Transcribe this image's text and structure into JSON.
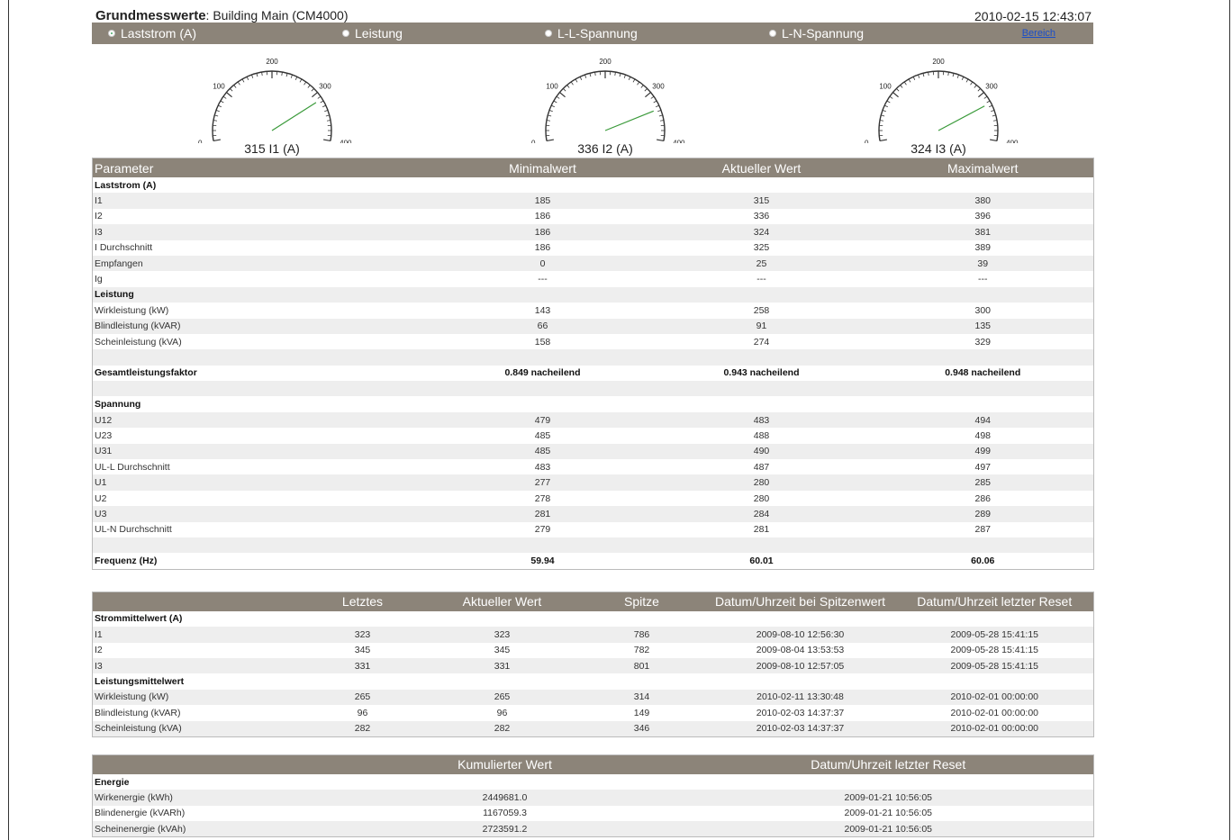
{
  "header": {
    "title_bold": "Grundmesswerte",
    "title_rest": ": Building Main (CM4000)",
    "timestamp": "2010-02-15 12:43:07"
  },
  "radios": [
    {
      "label": "Laststrom (A)",
      "selected": true
    },
    {
      "label": "Leistung",
      "selected": false
    },
    {
      "label": "L-L-Spannung",
      "selected": false
    },
    {
      "label": "L-N-Spannung",
      "selected": false
    }
  ],
  "bereich_link": "Bereich",
  "gauges": [
    {
      "value": 315,
      "label": "315 I1 (A)"
    },
    {
      "value": 336,
      "label": "336 I2 (A)"
    },
    {
      "value": 324,
      "label": "324 I3 (A)"
    }
  ],
  "gauge_scale": {
    "ticks": [
      "0",
      "100",
      "200",
      "300",
      "400"
    ],
    "min": 0,
    "max": 400
  },
  "main_table": {
    "headers": [
      "Parameter",
      "Minimalwert",
      "Aktueller Wert",
      "Maximalwert"
    ],
    "rows": [
      {
        "type": "section",
        "cells": [
          "Laststrom (A)",
          "",
          "",
          ""
        ]
      },
      {
        "type": "data",
        "cells": [
          "I1",
          "185",
          "315",
          "380"
        ]
      },
      {
        "type": "data",
        "cells": [
          "I2",
          "186",
          "336",
          "396"
        ]
      },
      {
        "type": "data",
        "cells": [
          "I3",
          "186",
          "324",
          "381"
        ]
      },
      {
        "type": "data",
        "cells": [
          "I Durchschnitt",
          "186",
          "325",
          "389"
        ]
      },
      {
        "type": "data",
        "cells": [
          "Empfangen",
          "0",
          "25",
          "39"
        ]
      },
      {
        "type": "data",
        "cells": [
          "Ig",
          "---",
          "---",
          "---"
        ]
      },
      {
        "type": "section",
        "cells": [
          "Leistung",
          "",
          "",
          ""
        ]
      },
      {
        "type": "data",
        "cells": [
          "Wirkleistung (kW)",
          "143",
          "258",
          "300"
        ]
      },
      {
        "type": "data",
        "cells": [
          "Blindleistung (kVAR)",
          "66",
          "91",
          "135"
        ]
      },
      {
        "type": "data",
        "cells": [
          "Scheinleistung (kVA)",
          "158",
          "274",
          "329"
        ]
      },
      {
        "type": "blank",
        "cells": [
          "",
          "",
          "",
          ""
        ]
      },
      {
        "type": "section",
        "cells": [
          "Gesamtleistungsfaktor",
          "0.849 nacheilend",
          "0.943 nacheilend",
          "0.948 nacheilend"
        ]
      },
      {
        "type": "blank",
        "cells": [
          "",
          "",
          "",
          ""
        ]
      },
      {
        "type": "section",
        "cells": [
          "Spannung",
          "",
          "",
          ""
        ]
      },
      {
        "type": "data",
        "cells": [
          "U12",
          "479",
          "483",
          "494"
        ]
      },
      {
        "type": "data",
        "cells": [
          "U23",
          "485",
          "488",
          "498"
        ]
      },
      {
        "type": "data",
        "cells": [
          "U31",
          "485",
          "490",
          "499"
        ]
      },
      {
        "type": "data",
        "cells": [
          "UL-L Durchschnitt",
          "483",
          "487",
          "497"
        ]
      },
      {
        "type": "data",
        "cells": [
          "U1",
          "277",
          "280",
          "285"
        ]
      },
      {
        "type": "data",
        "cells": [
          "U2",
          "278",
          "280",
          "286"
        ]
      },
      {
        "type": "data",
        "cells": [
          "U3",
          "281",
          "284",
          "289"
        ]
      },
      {
        "type": "data",
        "cells": [
          "UL-N Durchschnitt",
          "279",
          "281",
          "287"
        ]
      },
      {
        "type": "blank",
        "cells": [
          "",
          "",
          "",
          ""
        ]
      },
      {
        "type": "section",
        "cells": [
          "Frequenz (Hz)",
          "59.94",
          "60.01",
          "60.06"
        ]
      }
    ]
  },
  "demand_table": {
    "headers": [
      "",
      "Letztes",
      "Aktueller Wert",
      "Spitze",
      "Datum/Uhrzeit bei Spitzenwert",
      "Datum/Uhrzeit letzter Reset"
    ],
    "rows": [
      {
        "type": "section",
        "cells": [
          "Strommittelwert (A)",
          "",
          "",
          "",
          "",
          ""
        ]
      },
      {
        "type": "data",
        "cells": [
          "I1",
          "323",
          "323",
          "786",
          "2009-08-10 12:56:30",
          "2009-05-28 15:41:15"
        ]
      },
      {
        "type": "data",
        "cells": [
          "I2",
          "345",
          "345",
          "782",
          "2009-08-04 13:53:53",
          "2009-05-28 15:41:15"
        ]
      },
      {
        "type": "data",
        "cells": [
          "I3",
          "331",
          "331",
          "801",
          "2009-08-10 12:57:05",
          "2009-05-28 15:41:15"
        ]
      },
      {
        "type": "section",
        "cells": [
          "Leistungsmittelwert",
          "",
          "",
          "",
          "",
          ""
        ]
      },
      {
        "type": "data",
        "cells": [
          "Wirkleistung (kW)",
          "265",
          "265",
          "314",
          "2010-02-11 13:30:48",
          "2010-02-01 00:00:00"
        ]
      },
      {
        "type": "data",
        "cells": [
          "Blindleistung (kVAR)",
          "96",
          "96",
          "149",
          "2010-02-03 14:37:37",
          "2010-02-01 00:00:00"
        ]
      },
      {
        "type": "data",
        "cells": [
          "Scheinleistung (kVA)",
          "282",
          "282",
          "346",
          "2010-02-03 14:37:37",
          "2010-02-01 00:00:00"
        ]
      }
    ]
  },
  "energy_table": {
    "headers": [
      "",
      "Kumulierter Wert",
      "Datum/Uhrzeit letzter Reset"
    ],
    "rows": [
      {
        "type": "section",
        "cells": [
          "Energie",
          "",
          ""
        ]
      },
      {
        "type": "data",
        "cells": [
          "Wirkenergie (kWh)",
          "2449681.0",
          "2009-01-21 10:56:05"
        ]
      },
      {
        "type": "data",
        "cells": [
          "Blindenergie (kVARh)",
          "1167059.3",
          "2009-01-21 10:56:05"
        ]
      },
      {
        "type": "data",
        "cells": [
          "Scheinenergie (kVAh)",
          "2723591.2",
          "2009-01-21 10:56:05"
        ]
      }
    ]
  },
  "colors": {
    "header_bg": "#8c8479",
    "needle": "#3a9a3a",
    "alt_row": "#eeeeee",
    "link": "#1a4ec8"
  }
}
